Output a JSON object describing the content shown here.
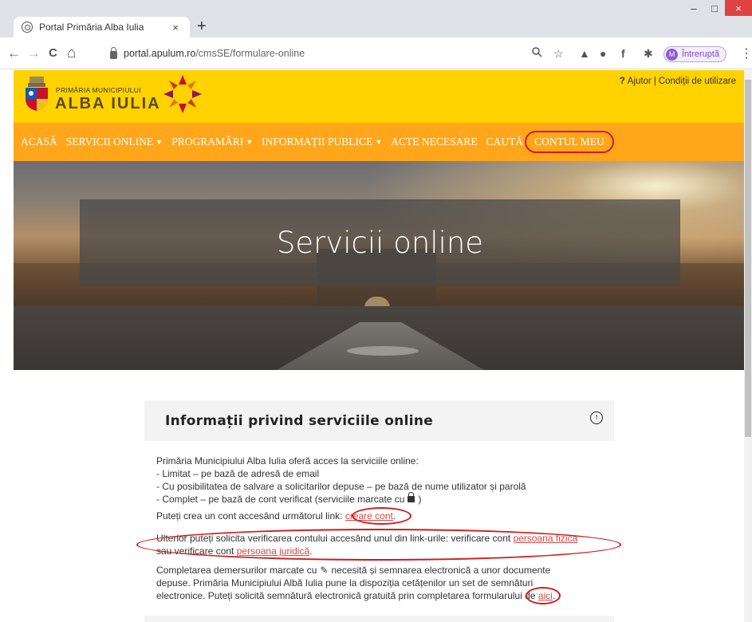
{
  "browser": {
    "tab_title": "Portal Primăria Alba Iulia",
    "tab_close": "×",
    "new_tab": "+",
    "url_domain": "portal.apulum.ro",
    "url_path": "/cmsSE/formulare-online",
    "profile_initial": "M",
    "profile_label": "Întreruptă",
    "back": "←",
    "forward": "→",
    "reload": "C",
    "home": "⌂",
    "window_minimize": "–",
    "window_maximize": "□",
    "window_close": "×"
  },
  "header": {
    "logo_small": "PRIMĂRIA MUNICIPIULUI",
    "logo_big": "ALBA IULIA",
    "help_q": "?",
    "help_label": "Ajutor",
    "terms_label": "Condiții de utilizare"
  },
  "nav": {
    "items": [
      {
        "label": "ACASĂ",
        "dropdown": false
      },
      {
        "label": "SERVICII ONLINE",
        "dropdown": true
      },
      {
        "label": "PROGRAMĂRI",
        "dropdown": true
      },
      {
        "label": "INFORMAȚII PUBLICE",
        "dropdown": true
      },
      {
        "label": "ACTE NECESARE",
        "dropdown": false
      },
      {
        "label": "CAUTĂ",
        "dropdown": false
      }
    ],
    "account_label": "CONTUL MEU"
  },
  "hero": {
    "title": "Servicii online"
  },
  "panel": {
    "title": "Informații privind serviciile online",
    "intro": "Primăria Municipiului Alba Iulia oferă acces la serviciile online:",
    "bullet1": "- Limitat – pe bază de adresă de email",
    "bullet2": "- Cu posibilitatea de salvare a solicitarilor depuse – pe bază de nume utilizator și parolă",
    "bullet3_pre": "- Complet – pe bază de cont verificat (serviciile marcate cu",
    "bullet3_post": ")",
    "create_pre": "Puteți crea un cont accesând următorul link:",
    "create_link": "creare cont",
    "create_post": ".",
    "verify_pre": "Ulterior puteți solicita verificarea contului accesând unul din link-urile: verificare cont",
    "verify_link1": "persoana fizica",
    "verify_mid": "sau verificare cont",
    "verify_link2": "persoana juridică",
    "verify_post": ".",
    "sign_pre": "Completarea demersurilor marcate cu",
    "sign_post": "necesită și semnarea electronică a unor documente",
    "sign_line2": "depuse. Primăria Municipiului Albă Iulia pune la dispoziția cetățenilor un set de semnături",
    "sign_line3_pre": "electronice. Puteți solicită semnătură electronică gratuită prin completarea formularului de",
    "sign_link": "aici",
    "sign_line3_post": "."
  },
  "colors": {
    "header_yellow": "#ffd200",
    "nav_orange": "#ffa61a",
    "annotation_red": "#d11a1a",
    "link_red": "#d14a4a"
  }
}
